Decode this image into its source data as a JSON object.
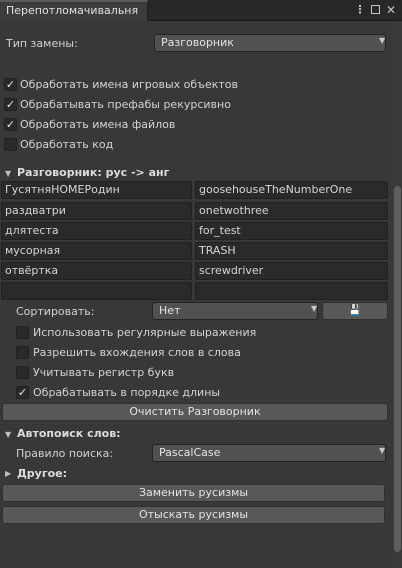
{
  "window": {
    "tab_title": "Перепотломачивальня",
    "menu_icon": "⋮",
    "close_icon": "✕"
  },
  "replace_type": {
    "label": "Тип замены:",
    "value": "Разговорник"
  },
  "options": [
    {
      "label": "Обработать имена игровых объектов",
      "checked": true
    },
    {
      "label": "Обрабатывать префабы рекурсивно",
      "checked": true
    },
    {
      "label": "Обработать имена файлов",
      "checked": true
    },
    {
      "label": "Обработать код",
      "checked": false
    }
  ],
  "phrasebook": {
    "title": "Разговорник: рус -> анг",
    "rows": [
      [
        "ГусятняHOMEРодин",
        "goosehouseTheNumberOne"
      ],
      [
        "раздватри",
        "onetwothree"
      ],
      [
        "длятеста",
        "for_test"
      ],
      [
        "мусорная",
        "TRASH"
      ],
      [
        "отвёртка",
        "screwdriver"
      ],
      [
        "",
        ""
      ]
    ]
  },
  "sort": {
    "label": "Сортировать:",
    "value": "Нет",
    "save_icon": "💾"
  },
  "sort_options": [
    {
      "label": "Использовать регулярные выражения",
      "checked": false
    },
    {
      "label": "Разрешить вхождения слов в слова",
      "checked": false
    },
    {
      "label": "Учитывать регистр букв",
      "checked": false
    },
    {
      "label": "Обрабатывать в порядке длины",
      "checked": true
    }
  ],
  "clear_button": "Очистить Разговорник",
  "autosearch": {
    "title": "Автопоиск слов:",
    "rule_label": "Правило поиска:",
    "rule_value": "PascalCase"
  },
  "other": {
    "title": "Другое:"
  },
  "replace_button": "Заменить русизмы",
  "find_button": "Отыскать русизмы",
  "check_glyph": "✓"
}
